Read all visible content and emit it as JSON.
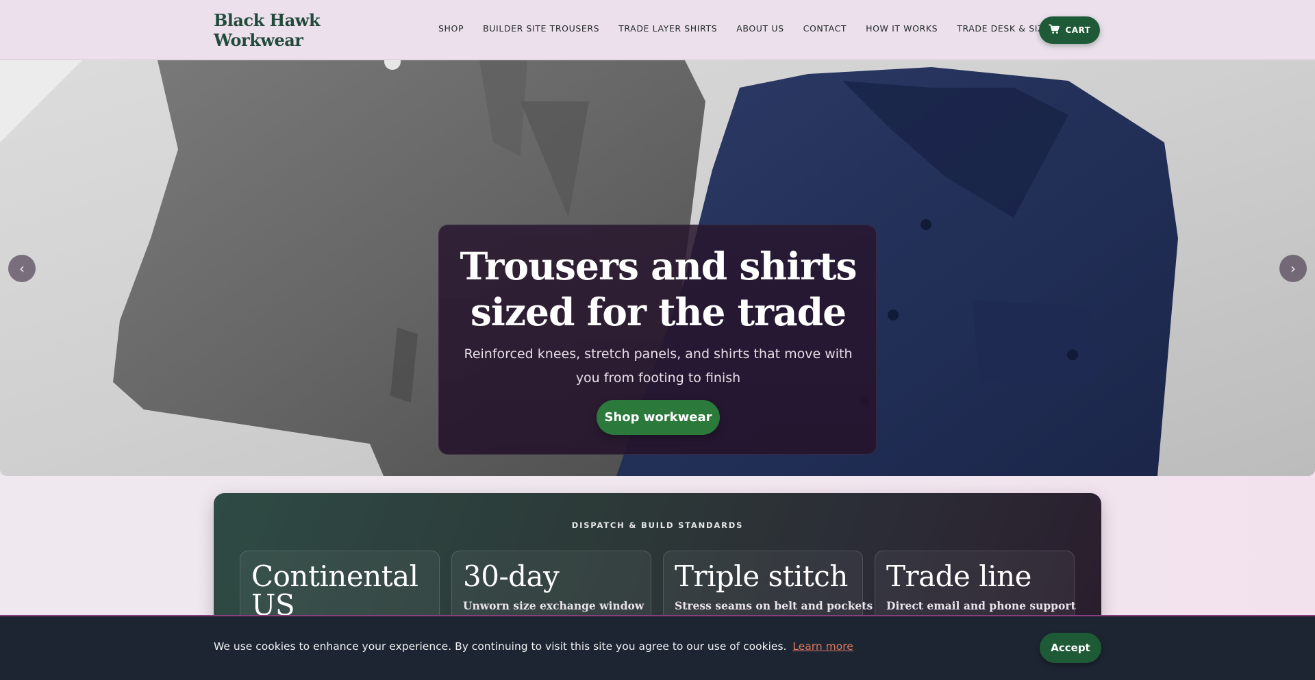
{
  "header": {
    "logo": "Black Hawk Workwear",
    "nav": [
      {
        "label": "SHOP"
      },
      {
        "label": "BUILDER SITE TROUSERS"
      },
      {
        "label": "TRADE LAYER SHIRTS"
      },
      {
        "label": "ABOUT US"
      },
      {
        "label": "CONTACT"
      },
      {
        "label": "HOW IT WORKS"
      },
      {
        "label": "TRADE DESK & SIZING"
      }
    ],
    "cart_label": "CART",
    "cart_icon": "cart-icon"
  },
  "hero": {
    "title": "Trousers and shirts sized for the trade",
    "subtitle": "Reinforced knees, stretch panels, and shirts that move with you from footing to finish",
    "cta_label": "Shop workwear",
    "prev_icon": "chevron-left-icon",
    "next_icon": "chevron-right-icon"
  },
  "standards": {
    "heading": "DISPATCH & BUILD STANDARDS",
    "items": [
      {
        "title": "Continental US",
        "desc": ""
      },
      {
        "title": "30-day",
        "desc": "Unworn size exchange window"
      },
      {
        "title": "Triple stitch",
        "desc": "Stress seams on belt and pockets"
      },
      {
        "title": "Trade line",
        "desc": "Direct email and phone support"
      }
    ]
  },
  "cookie": {
    "text": "We use cookies to enhance your experience. By continuing to visit this site you agree to our use of cookies.",
    "link_label": "Learn more",
    "accept_label": "Accept"
  },
  "colors": {
    "brand_green": "#1e5a37",
    "cta_green": "#2b7a3c",
    "header_bg": "#ece0ec",
    "cookie_bg": "#1d2533",
    "link_orange": "#e07a5f"
  }
}
